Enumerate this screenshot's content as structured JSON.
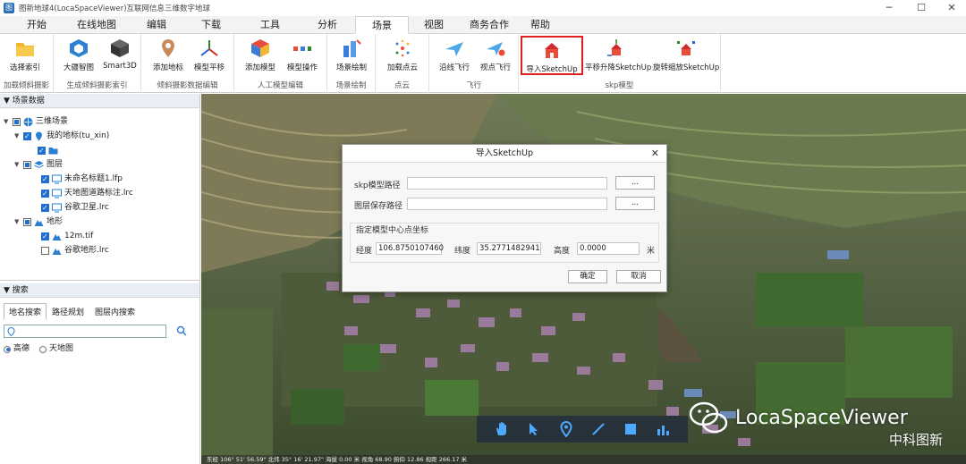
{
  "window": {
    "title": "图新地球4(LocaSpaceViewer)互联网信息三维数字地球",
    "minimize": "─",
    "maximize": "☐",
    "close": "✕"
  },
  "menu": [
    "开始",
    "在线地图",
    "编辑",
    "下载",
    "工具",
    "分析",
    "场景",
    "视图",
    "商务合作",
    "帮助"
  ],
  "ribbon": {
    "groups": [
      {
        "label": "加载倾斜摄影",
        "buttons": [
          "选择索引"
        ]
      },
      {
        "label": "生成倾斜摄影索引",
        "buttons": [
          "大疆智图",
          "Smart3D"
        ]
      },
      {
        "label": "倾斜摄影数据编辑",
        "buttons": [
          "添加地标",
          "模型平移"
        ]
      },
      {
        "label": "人工模型编辑",
        "buttons": [
          "添加模型",
          "模型操作"
        ]
      },
      {
        "label": "场景绘制",
        "buttons": [
          "场景绘制"
        ]
      },
      {
        "label": "点云",
        "buttons": [
          "加载点云"
        ]
      },
      {
        "label": "飞行",
        "buttons": [
          "沿线飞行",
          "视点飞行"
        ]
      },
      {
        "label": "skp模型",
        "buttons": [
          "导入SketchUp",
          "平移升降SketchUp",
          "旋转缩放SketchUp"
        ]
      }
    ]
  },
  "left_panel": {
    "scene_header": "场景数据",
    "tree": {
      "root": "三维场景",
      "my_places": "我的地标(tu_xin)",
      "layers": "图层",
      "layer_items": [
        "未命名标题1.lfp",
        "天地图道路标注.lrc",
        "谷歌卫星.lrc"
      ],
      "terrain": "地形",
      "terrain_items": [
        "12m.tif",
        "谷歌地形.lrc"
      ]
    },
    "search_header": "搜索",
    "search_tabs": [
      "地名搜索",
      "路径规划",
      "图层内搜索"
    ],
    "search_placeholder": "",
    "sources": [
      "高德",
      "天地图"
    ]
  },
  "dialog": {
    "title": "导入SketchUp",
    "skp_path_label": "skp模型路径",
    "save_path_label": "图层保存路径",
    "skp_path_value": "",
    "save_path_value": "",
    "browse_label": "...",
    "center_group_label": "指定模型中心点坐标",
    "lon_label": "经度",
    "lon_value": "106.8750107460",
    "lat_label": "纬度",
    "lat_value": "35.2771482941",
    "height_label": "高度",
    "height_value": "0.0000",
    "height_unit": "米",
    "ok_label": "确定",
    "cancel_label": "取消"
  },
  "status": {
    "text": "东经 106° 51' 56.59\"  北纬 35° 16' 21.97\"  海拔 0.00 米                                                                                                                      视角 68.90  俯仰 12.86  视距 266.17 米"
  },
  "watermark": {
    "brand": "LocaSpaceViewer",
    "sub": "中科图新"
  }
}
